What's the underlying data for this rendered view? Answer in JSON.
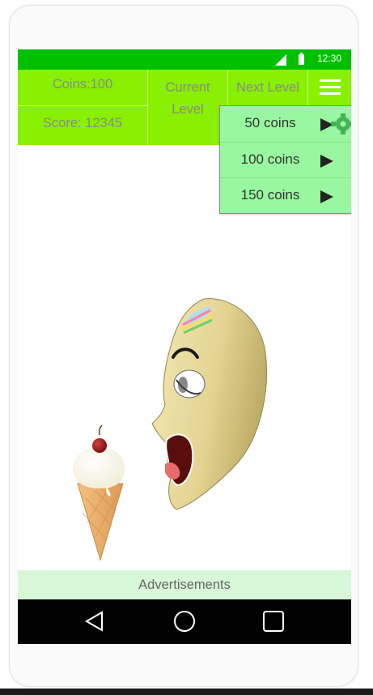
{
  "status_bar": {
    "time": "12:30",
    "background_color": "#00c000",
    "icons": [
      "signal-icon",
      "battery-icon"
    ]
  },
  "header": {
    "coins_label": "Coins:100",
    "score_label": "Score: 12345",
    "current_level_label": "Current Level",
    "next_level_label": "Next Level",
    "menu_icon": "hamburger-menu-icon",
    "settings_icon": "gear-icon",
    "background_color": "#88f000"
  },
  "coin_menu": {
    "items": [
      {
        "label": "50 coins",
        "icon": "play-arrow-icon"
      },
      {
        "label": "100 coins",
        "icon": "play-arrow-icon"
      },
      {
        "label": "150 coins",
        "icon": "play-arrow-icon"
      }
    ],
    "background_color": "#98f7a0"
  },
  "scene": {
    "characters": [
      "cartoon-head",
      "ice-cream-cone"
    ]
  },
  "ad_bar": {
    "label": "Advertisements",
    "background_color": "#d7f7d6"
  },
  "nav_bar": {
    "icons": [
      "back-icon",
      "home-icon",
      "recents-icon"
    ]
  }
}
